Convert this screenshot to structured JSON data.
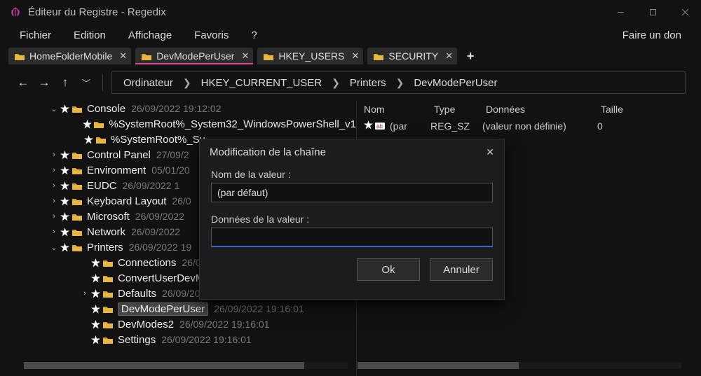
{
  "window": {
    "title": "Éditeur du Registre - Regedix"
  },
  "menu": {
    "file": "Fichier",
    "edit": "Edition",
    "view": "Affichage",
    "favorites": "Favoris",
    "help": "?",
    "donate": "Faire un don"
  },
  "tabs": [
    {
      "label": "HomeFolderMobile"
    },
    {
      "label": "DevModePerUser"
    },
    {
      "label": "HKEY_USERS"
    },
    {
      "label": "SECURITY"
    }
  ],
  "breadcrumbs": [
    "Ordinateur",
    "HKEY_CURRENT_USER",
    "Printers",
    "DevModePerUser"
  ],
  "tree": [
    {
      "indent": 1,
      "exp": "v",
      "star": true,
      "name": "Console",
      "ts": "26/09/2022 19:12:02"
    },
    {
      "indent": 2,
      "exp": "",
      "star": true,
      "name": "%SystemRoot%_System32_WindowsPowerShell_v1",
      "ts": ""
    },
    {
      "indent": 2,
      "exp": "",
      "star": true,
      "name": "%SystemRoot%_Sy",
      "ts": ""
    },
    {
      "indent": 1,
      "exp": ">",
      "star": true,
      "name": "Control Panel",
      "ts": "27/09/2"
    },
    {
      "indent": 1,
      "exp": ">",
      "star": true,
      "name": "Environment",
      "ts": "05/01/20"
    },
    {
      "indent": 1,
      "exp": ">",
      "star": true,
      "name": "EUDC",
      "ts": "26/09/2022 1"
    },
    {
      "indent": 1,
      "exp": ">",
      "star": true,
      "name": "Keyboard Layout",
      "ts": "26/0"
    },
    {
      "indent": 1,
      "exp": ">",
      "star": true,
      "name": "Microsoft",
      "ts": "26/09/2022"
    },
    {
      "indent": 1,
      "exp": ">",
      "star": true,
      "name": "Network",
      "ts": "26/09/2022"
    },
    {
      "indent": 1,
      "exp": "v",
      "star": true,
      "name": "Printers",
      "ts": "26/09/2022 19"
    },
    {
      "indent": 3,
      "exp": "",
      "star": true,
      "name": "Connections",
      "ts": "26/09/2"
    },
    {
      "indent": 3,
      "exp": "",
      "star": true,
      "name": "ConvertUserDevMo",
      "ts": ""
    },
    {
      "indent": 3,
      "exp": ">",
      "star": true,
      "name": "Defaults",
      "ts": "26/09/202"
    },
    {
      "indent": 3,
      "exp": "",
      "star": true,
      "selected": true,
      "name": "DevModePerUser",
      "ts": "26/09/2022 19:16:01"
    },
    {
      "indent": 3,
      "exp": "",
      "star": true,
      "name": "DevModes2",
      "ts": "26/09/2022 19:16:01"
    },
    {
      "indent": 3,
      "exp": "",
      "star": true,
      "name": "Settings",
      "ts": "26/09/2022 19:16:01"
    }
  ],
  "list": {
    "headers": {
      "name": "Nom",
      "type": "Type",
      "data": "Données",
      "size": "Taille"
    },
    "rows": [
      {
        "name": "(par",
        "type": "REG_SZ",
        "data": "(valeur non définie)",
        "size": "0"
      }
    ]
  },
  "dialog": {
    "title": "Modification de la chaîne",
    "name_label": "Nom de la valeur :",
    "name_value": "(par défaut)",
    "data_label": "Données de la valeur :",
    "data_value": "",
    "ok": "Ok",
    "cancel": "Annuler"
  }
}
